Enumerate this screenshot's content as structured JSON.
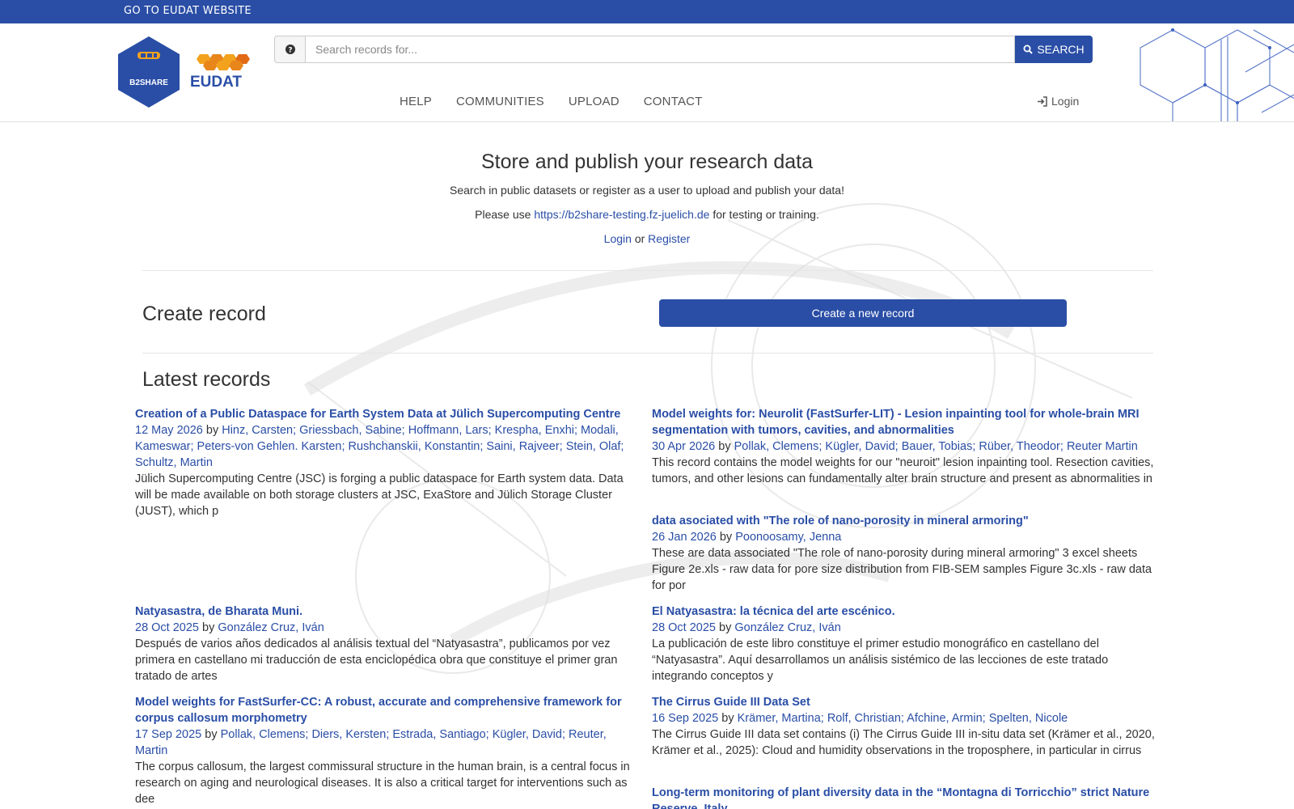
{
  "topbar": {
    "link": "GO TO EUDAT WEBSITE"
  },
  "logo": {
    "b2share_label": "B2SHARE",
    "eudat_label": "EUDAT"
  },
  "search": {
    "placeholder": "Search records for...",
    "button": "SEARCH"
  },
  "nav": {
    "items": [
      "HELP",
      "COMMUNITIES",
      "UPLOAD",
      "CONTACT"
    ],
    "login": "Login"
  },
  "hero": {
    "title": "Store and publish your research data",
    "subtitle": "Search in public datasets or register as a user to upload and publish your data!",
    "please_use": "Please use",
    "testing_url": "https://b2share-testing.fz-juelich.de",
    "for_testing": "for testing or training.",
    "login": "Login",
    "or": "or",
    "register": "Register"
  },
  "create": {
    "heading": "Create record",
    "button": "Create a new record"
  },
  "latest": {
    "heading": "Latest records",
    "by": "by",
    "records": [
      {
        "title": "Creation of a Public Dataspace for Earth System Data at Jülich Supercomputing Centre",
        "date": "12 May 2026",
        "authors": "Hinz, Carsten; Griessbach, Sabine; Hoffmann, Lars; Krespha, Enxhi; Modali, Kameswar; Peters-von Gehlen. Karsten; Rushchanskii, Konstantin; Saini, Rajveer; Stein, Olaf; Schultz, Martin",
        "summary": "Jülich Supercomputing Centre (JSC) is forging a public dataspace for Earth system data. Data will be made available on both storage clusters at JSC, ExaStore and Jülich Storage Cluster (JUST), which p"
      },
      {
        "title": "Model weights for: Neurolit (FastSurfer-LIT) - Lesion inpainting tool for whole-brain MRI segmentation with tumors, cavities, and abnormalities",
        "date": "30 Apr 2026",
        "authors": "Pollak, Clemens; Kügler, David; Bauer, Tobias; Rüber, Theodor; Reuter Martin",
        "summary": "This record contains the model weights for our \"neuroit\" lesion inpainting tool. Resection cavities, tumors, and other lesions can fundamentally alter brain structure and present as abnormalities in"
      },
      {
        "title": "data asociated with \"The role of nano-porosity in mineral armoring\"",
        "date": "26 Jan 2026",
        "authors": "Poonoosamy, Jenna",
        "summary": "These are data associated \"The role of nano-porosity during mineral armoring\" 3 excel sheets Figure 2e.xls - raw data for pore size distribution from FIB-SEM samples Figure 3c.xls - raw data for por"
      },
      {
        "title": "Natyasastra, de Bharata Muni.",
        "date": "28 Oct 2025",
        "authors": "González Cruz, Iván",
        "summary": "Después de varios años dedicados al análisis textual del “Natyasastra”, publicamos por vez primera en castellano mi traducción de esta enciclopédica obra que constituye el primer gran tratado de artes"
      },
      {
        "title": "El Natyasastra: la técnica del arte escénico.",
        "date": "28 Oct 2025",
        "authors": "González Cruz, Iván",
        "summary": "La publicación de este libro constituye el primer estudio monográfico en castellano del “Natyasastra”. Aquí desarrollamos un análisis sistémico de las lecciones de este tratado integrando conceptos y"
      },
      {
        "title": "Model weights for FastSurfer-CC: A robust, accurate and comprehensive framework for corpus callosum morphometry",
        "date": "17 Sep 2025",
        "authors": "Pollak, Clemens; Diers, Kersten; Estrada, Santiago; Kügler, David; Reuter, Martin",
        "summary": "The corpus callosum, the largest commissural structure in the human brain, is a central focus in research on aging and neurological diseases. It is also a critical target for interventions such as dee"
      },
      {
        "title": "The Cirrus Guide III Data Set",
        "date": "16 Sep 2025",
        "authors": "Krämer, Martina; Rolf, Christian; Afchine, Armin; Spelten, Nicole",
        "summary": "The Cirrus Guide III data set contains (i) The Cirrus Guide III in-situ data set (Krämer et al., 2020, Krämer et al., 2025): Cloud and humidity observations in the troposphere, in particular in cirrus"
      },
      {
        "title": "Long-term monitoring of plant diversity data in the “Montagna di Torricchio” strict Nature Reserve, Italy",
        "date": "",
        "authors": "",
        "summary": ""
      }
    ]
  },
  "colors": {
    "brand": "#2a4ea6",
    "text": "#333333"
  }
}
